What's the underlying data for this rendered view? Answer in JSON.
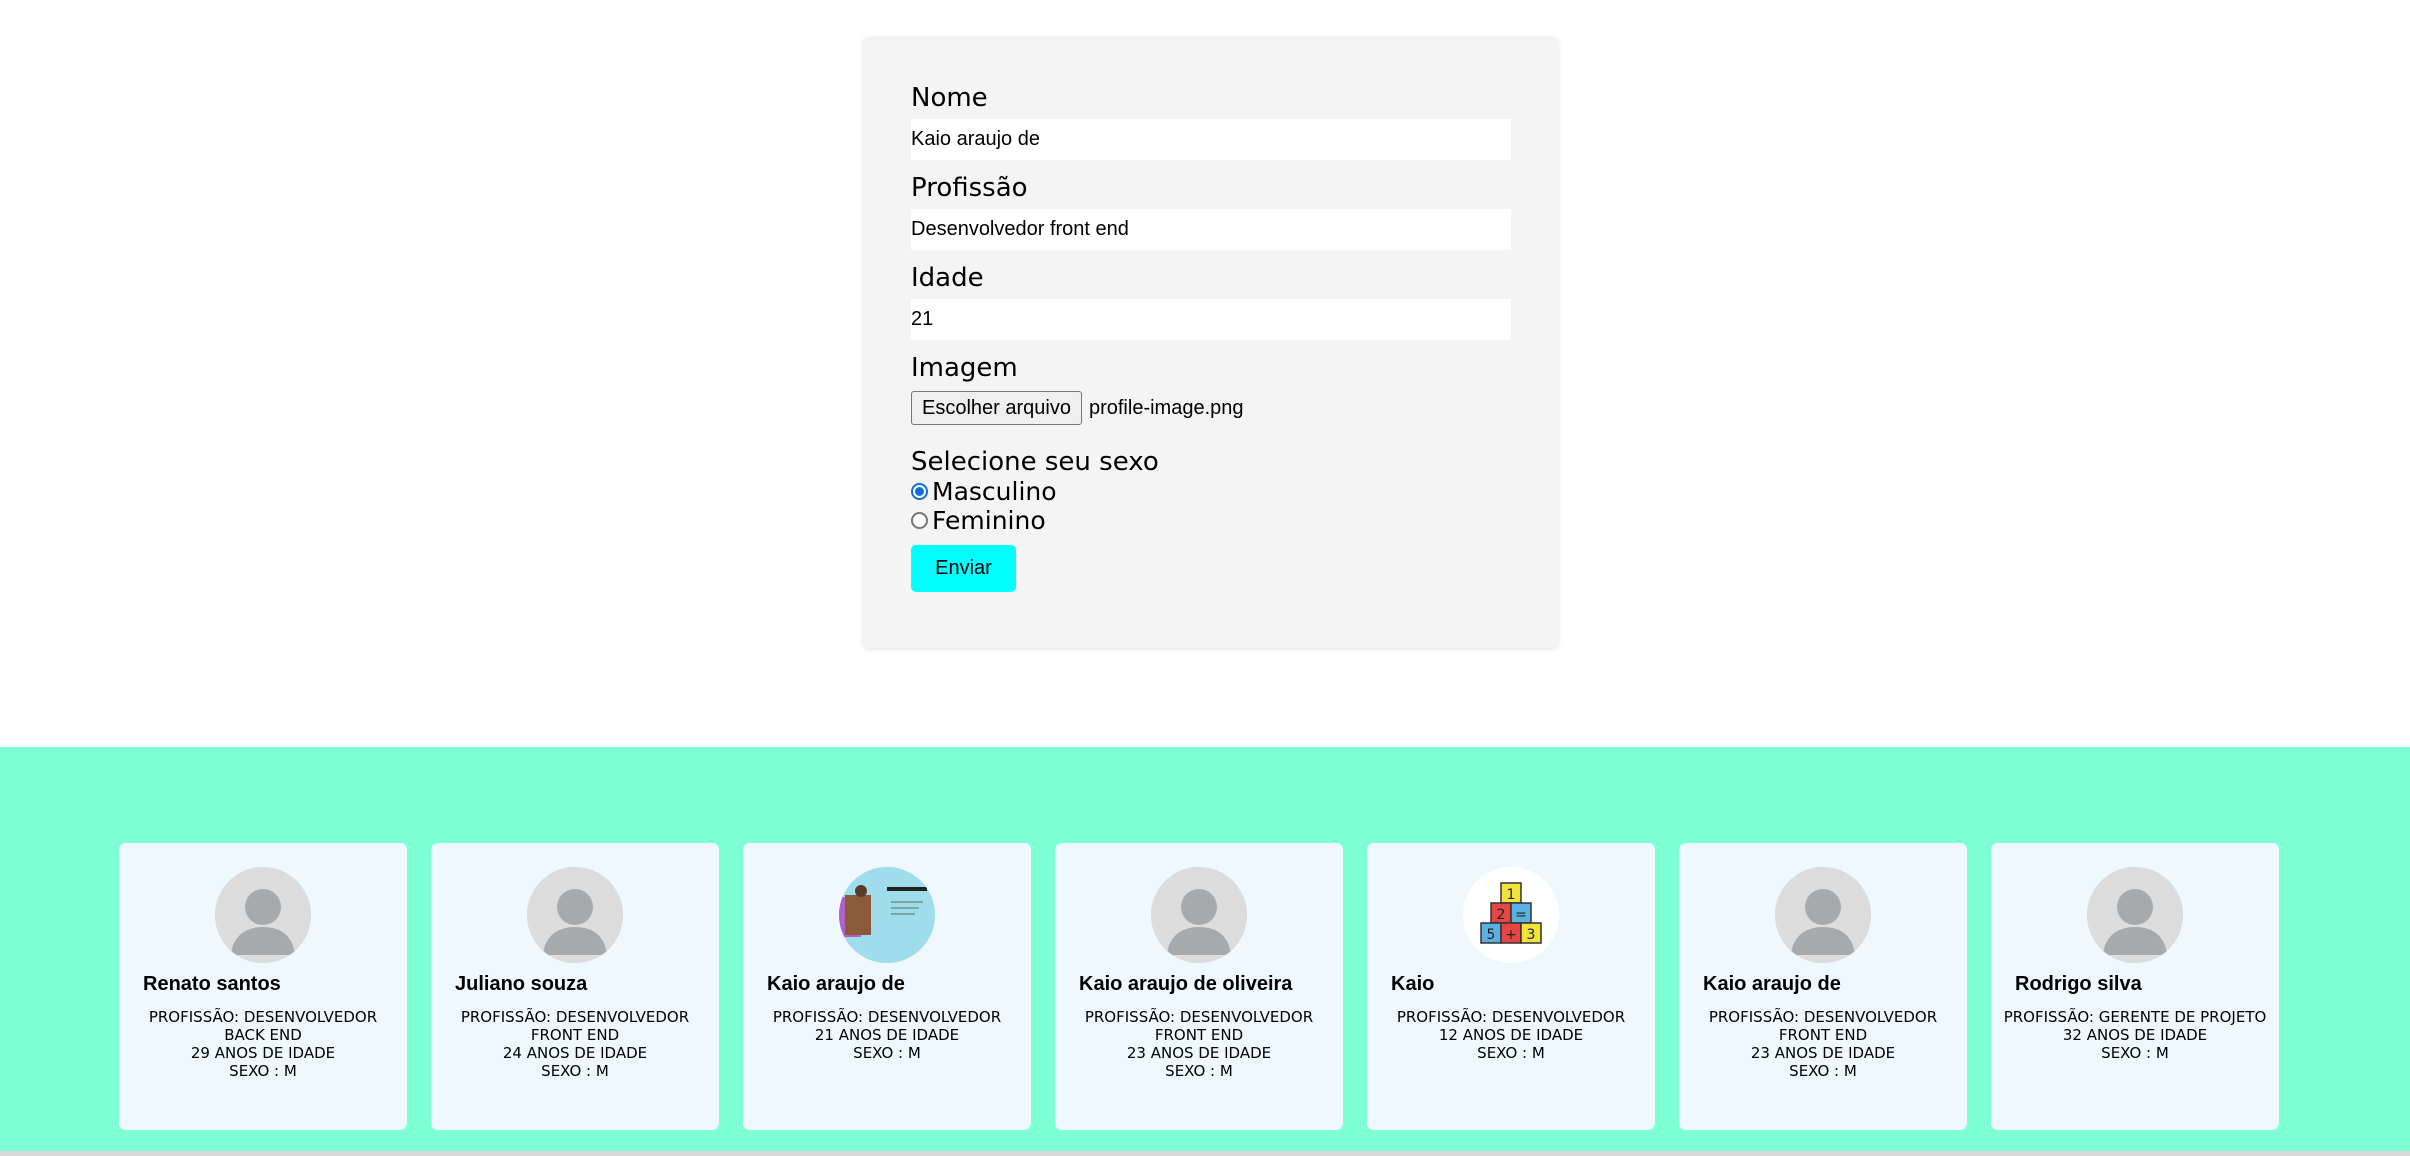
{
  "form": {
    "name_label": "Nome",
    "name_value": "Kaio araujo de",
    "profession_label": "Profissão",
    "profession_value": "Desenvolvedor front end",
    "age_label": "Idade",
    "age_value": "21",
    "image_label": "Imagem",
    "file_button_label": "Escolher arquivo",
    "file_name": "profile-image.png",
    "sex_label": "Selecione seu sexo",
    "radio_male": "Masculino",
    "radio_female": "Feminino",
    "selected_sex": "Masculino",
    "submit_label": "Enviar"
  },
  "colors": {
    "band_background": "#7fffd4",
    "card_background": "#f0f8ff",
    "submit_background": "#00ffff",
    "form_background": "#f4f4f4"
  },
  "cards": [
    {
      "name": "Renato santos",
      "profession": "PROFISSÃO: DESENVOLVEDOR BACK END",
      "age": "29 ANOS DE IDADE",
      "sex": "SEXO : M",
      "avatar": "default-avatar-icon"
    },
    {
      "name": "Juliano souza",
      "profession": "PROFISSÃO: DESENVOLVEDOR FRONT END",
      "age": "24 ANOS DE IDADE",
      "sex": "SEXO : M",
      "avatar": "default-avatar-icon"
    },
    {
      "name": "Kaio araujo de",
      "profession": "PROFISSÃO: DESENVOLVEDOR",
      "age": "21 ANOS DE IDADE",
      "sex": "SEXO : M",
      "avatar": "profile-photo"
    },
    {
      "name": "Kaio araujo de oliveira",
      "profession": "PROFISSÃO: DESENVOLVEDOR FRONT END",
      "age": "23 ANOS DE IDADE",
      "sex": "SEXO : M",
      "avatar": "default-avatar-icon"
    },
    {
      "name": "Kaio",
      "profession": "PROFISSÃO: DESENVOLVEDOR",
      "age": "12 ANOS DE IDADE",
      "sex": "SEXO : M",
      "avatar": "math-blocks-image"
    },
    {
      "name": "Kaio araujo de",
      "profession": "PROFISSÃO: DESENVOLVEDOR FRONT END",
      "age": "23 ANOS DE IDADE",
      "sex": "SEXO : M",
      "avatar": "default-avatar-icon"
    },
    {
      "name": "Rodrigo silva",
      "profession": "PROFISSÃO: GERENTE DE PROJETO",
      "age": "32 ANOS DE IDADE",
      "sex": "SEXO : M",
      "avatar": "default-avatar-icon"
    }
  ]
}
